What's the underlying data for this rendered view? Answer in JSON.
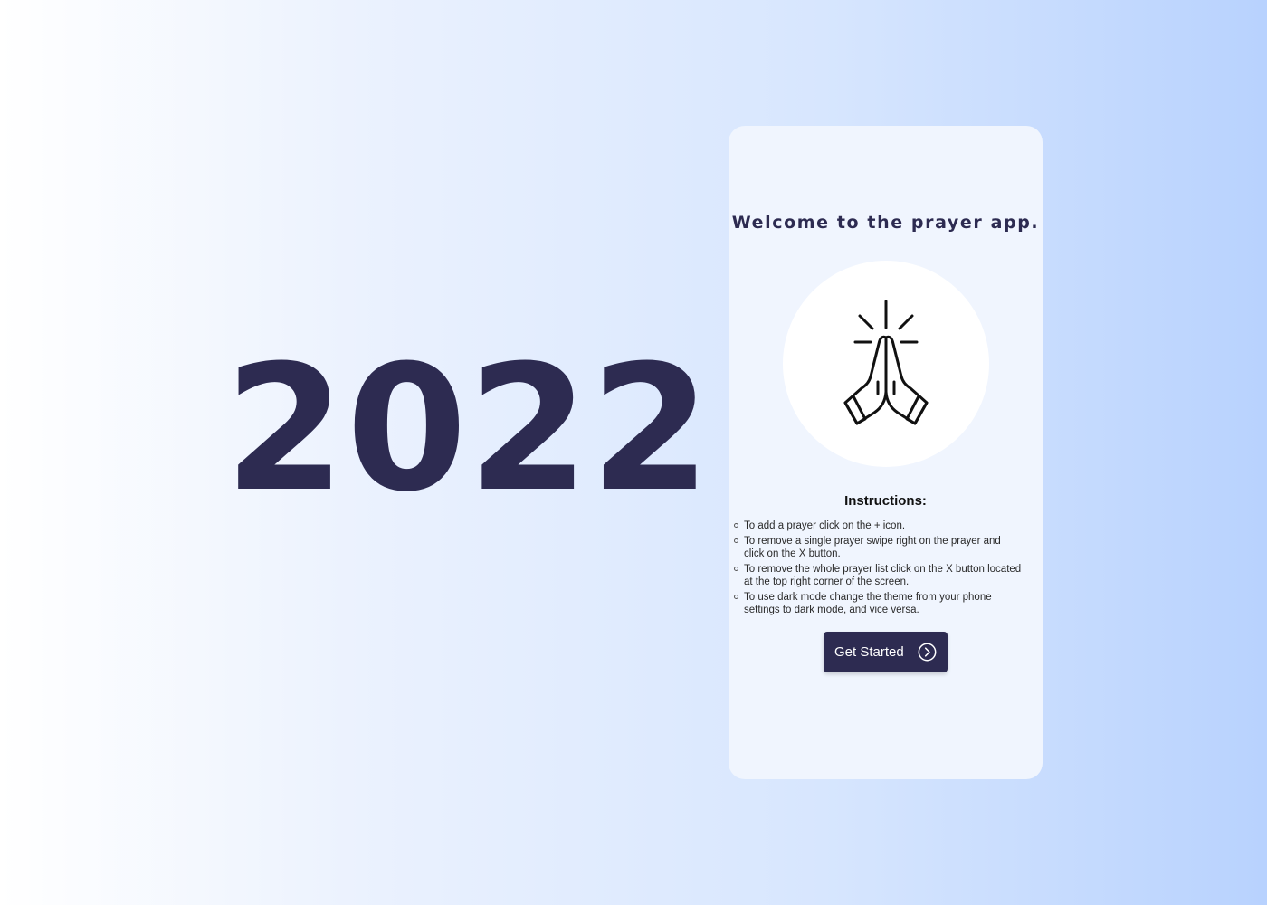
{
  "hero": {
    "year": "2022"
  },
  "app": {
    "welcome_title": "Welcome to the prayer app.",
    "hero_icon": "praying-hands-icon",
    "instructions_title": "Instructions:",
    "instructions": [
      "To add a prayer click on the + icon.",
      "To remove a single prayer swipe right on the prayer and click on the X button.",
      "To remove the whole prayer list click on the X button located at the top right corner of the screen.",
      "To use dark mode change the theme from your phone settings to dark mode, and vice versa."
    ],
    "cta_label": "Get Started",
    "cta_icon": "chevron-right-circle-icon"
  },
  "colors": {
    "primary": "#2d2b51",
    "card_background": "#f0f5fe",
    "gradient_start": "#ffffff",
    "gradient_end": "#b8d2fe"
  }
}
